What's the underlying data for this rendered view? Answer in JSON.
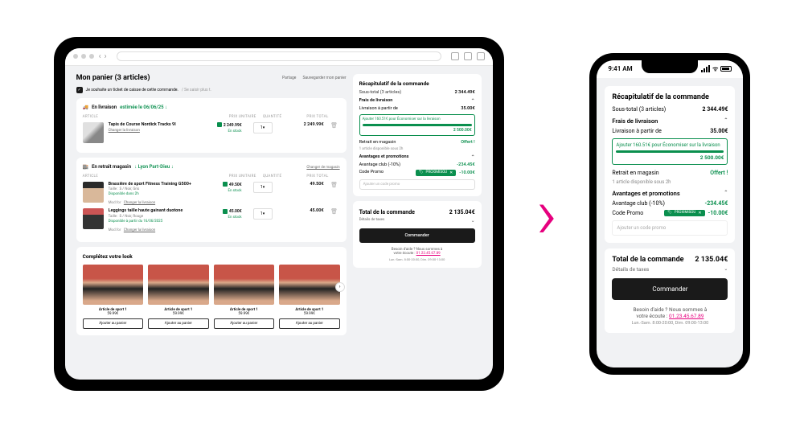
{
  "cart": {
    "title": "Mon panier (3 articles)",
    "share": "Partage",
    "save": "Sauvegarder mon panier",
    "tax_note": "Je souhaite un ticket de caisse de cette commande.",
    "save_later": "/ Se saisir plus t."
  },
  "delivery_group": {
    "label": "En livraison",
    "eta": "estimée le 06/06/25 ↓",
    "th": {
      "article": "ARTICLE",
      "unit": "PRIX UNITAIRE",
      "qty": "QUANTITÉ",
      "total": "PRIX TOTAL"
    },
    "item": {
      "name": "Tapis de Course Nordick Tracks 9l",
      "change": "Changer la livraison",
      "unit": "2 249.99€",
      "qty": "1",
      "total": "2 249.99€",
      "stock": "En stock"
    }
  },
  "pickup_group": {
    "label": "En retrait magasin",
    "store": "↓ Lyon Part-Dieu ↓",
    "change": "Changer de magasin",
    "items": [
      {
        "name": "Brassière de sport Fitness Training G500+",
        "meta": "Taille : S / Noir, Gris",
        "avail": "Disponible dans 2h",
        "mod": "Mod.for",
        "change": "Changer la livraison",
        "unit": "49.50€",
        "qty": "1",
        "total": "49.50€",
        "stock": "En stock"
      },
      {
        "name": "Leggings taille haute gainant duotone",
        "meta": "Taille : S / Noir, Rouge",
        "avail": "Disponible à partir du 16/06/2025",
        "mod": "Mod.for",
        "change": "Changer la livraison",
        "unit": "45.00€",
        "qty": "1",
        "total": "45.00€",
        "stock": "En stock"
      }
    ]
  },
  "complete": {
    "title": "Complétez votre look",
    "products": [
      {
        "name": "Article de sport 1",
        "price": "59.99€",
        "btn": "Ajouter au panier"
      },
      {
        "name": "Article de sport 1",
        "price": "59.99€",
        "btn": "Ajouter au panier"
      },
      {
        "name": "Article de sport 1",
        "price": "59.99€",
        "btn": "Ajouter au panier"
      },
      {
        "name": "Article de sport 1",
        "price": "59.99€",
        "btn": "Ajouter au panier"
      }
    ]
  },
  "summary": {
    "title": "Récapitulatif de la commande",
    "subtotal_label": "Sous-total (3 articles)",
    "subtotal": "2 344.49€",
    "ship_title": "Frais de livraison",
    "ship_from": "Livraison à partir de",
    "ship_cost": "35.00€",
    "threshold_msg": "Ajouter 160.51€ pour Économiser sur la livraison",
    "threshold_amt": "2 500.00€",
    "pickup_label": "Retrait en magasin",
    "pickup_val": "Offert !",
    "pickup_sub": "1 article disponible sous 2h",
    "adv_title": "Avantages et promotions",
    "club_label": "Avantage club (-10%)",
    "club_val": "-234.45€",
    "promo_label": "Code Promo",
    "promo_code": "PROXIMISOU",
    "promo_val": "-10.00€",
    "promo_placeholder": "Ajouter un code promo",
    "total_label": "Total de la commande",
    "total": "2 135.04€",
    "tax_label": "Détails de taxes",
    "order_btn": "Commander",
    "help1": "Besoin d'aide ? Nous sommes à",
    "help2": "votre écoute :",
    "help_phone": "01.23.45.67.89",
    "help_hours": "Lun.-Sam. 8:00-20:00, Dim. 09:00-13:00"
  },
  "phone": {
    "time": "9:41 AM"
  }
}
